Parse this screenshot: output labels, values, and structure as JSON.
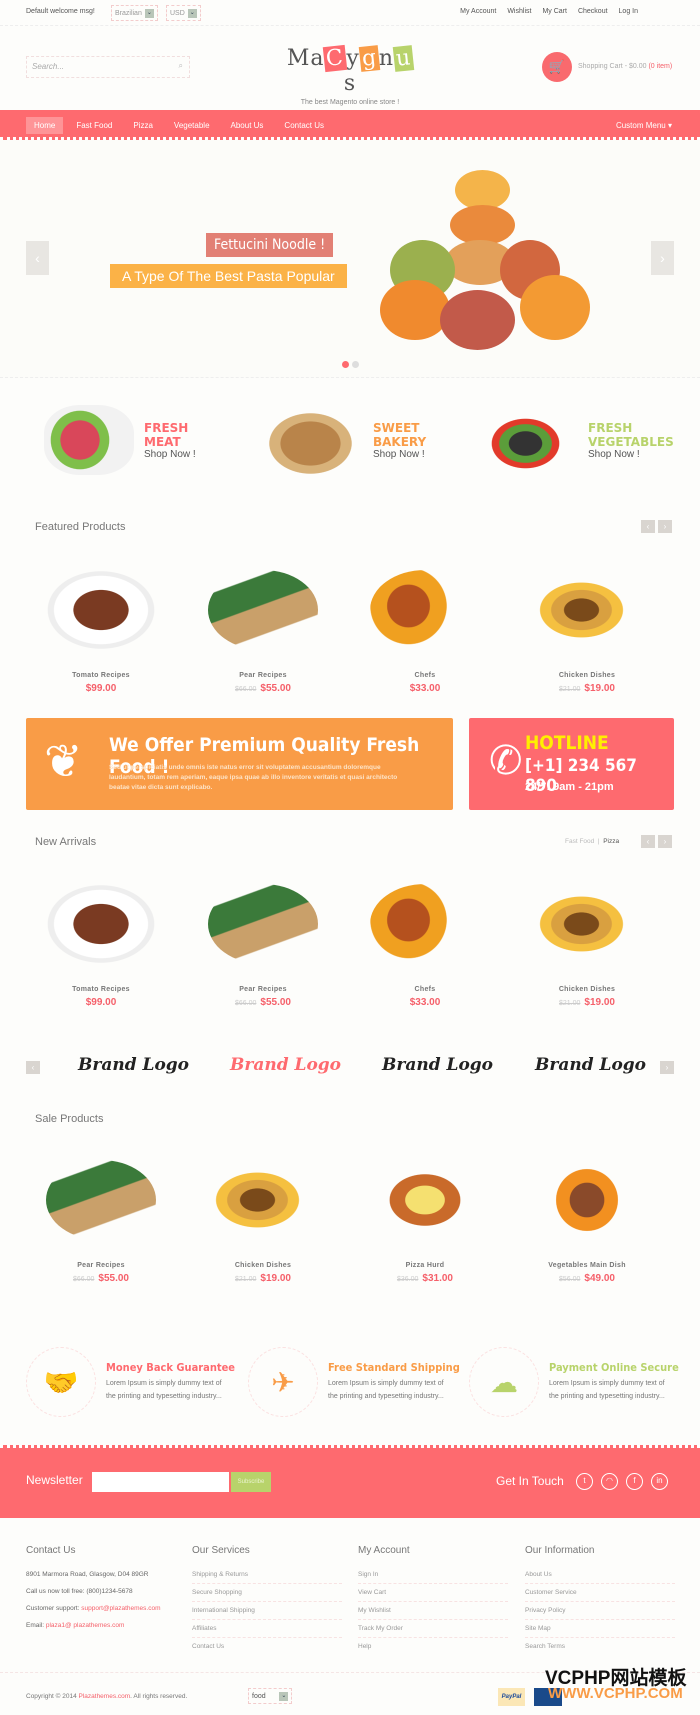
{
  "topbar": {
    "welcome": "Default welcome msg!",
    "language": "Brazilian",
    "currency": "USD",
    "links": [
      "My Account",
      "Wishlist",
      "My Cart",
      "Checkout",
      "Log In"
    ]
  },
  "header": {
    "search_placeholder": "Search...",
    "logo_text": "MaCygnus",
    "tagline": "The best Magento online store !",
    "cart_label": "Shopping Cart -",
    "cart_total": "$0.00",
    "cart_items": "(0 item)"
  },
  "nav": {
    "items": [
      "Home",
      "Fast Food",
      "Pizza",
      "Vegetable",
      "About Us",
      "Contact Us"
    ],
    "custom_menu": "Custom Menu"
  },
  "slider": {
    "caption1": "Fettucini Noodle !",
    "caption2": "A Type Of The Best Pasta Popular"
  },
  "categories": [
    {
      "line1": "FRESH",
      "line2": "MEAT",
      "cta": "Shop Now !",
      "color": "#fe6a6f"
    },
    {
      "line1": "SWEET",
      "line2": "BAKERY",
      "cta": "Shop Now !",
      "color": "#f99c47"
    },
    {
      "line1": "FRESH",
      "line2": "VEGETABLES",
      "cta": "Shop Now !",
      "color": "#b8d36b"
    }
  ],
  "featured": {
    "title": "Featured Products",
    "products": [
      {
        "name": "Tomato Recipes",
        "price": "$99.00",
        "old": ""
      },
      {
        "name": "Pear Recipes",
        "price": "$55.00",
        "old": "$66.00"
      },
      {
        "name": "Chefs",
        "price": "$33.00",
        "old": ""
      },
      {
        "name": "Chicken Dishes",
        "price": "$19.00",
        "old": "$21.00"
      }
    ]
  },
  "promo": {
    "title": "We Offer Premium Quality Fresh Food !",
    "text": "Sed ut perspiciatis unde omnis iste natus error sit voluptatem accusantium doloremque laudantium, totam rem aperiam, eaque ipsa quae ab illo inventore veritatis et quasi architecto beatae vitae dicta sunt explicabo."
  },
  "hotline": {
    "title": "HOTLINE",
    "phone": "[+1] 234 567 890",
    "hours": "24/7: 9am - 21pm"
  },
  "new_arrivals": {
    "title": "New Arrivals",
    "tabs": [
      "Fast Food",
      "Pizza"
    ],
    "products": [
      {
        "name": "Tomato Recipes",
        "price": "$99.00",
        "old": ""
      },
      {
        "name": "Pear Recipes",
        "price": "$55.00",
        "old": "$66.00"
      },
      {
        "name": "Chefs",
        "price": "$33.00",
        "old": ""
      },
      {
        "name": "Chicken Dishes",
        "price": "$19.00",
        "old": "$21.00"
      }
    ]
  },
  "brands": [
    "Brand Logo",
    "Brand Logo",
    "Brand Logo",
    "Brand Logo"
  ],
  "sale": {
    "title": "Sale Products",
    "products": [
      {
        "name": "Pear Recipes",
        "price": "$55.00",
        "old": "$66.00"
      },
      {
        "name": "Chicken Dishes",
        "price": "$19.00",
        "old": "$21.00"
      },
      {
        "name": "Pizza Hurd",
        "price": "$31.00",
        "old": "$36.00"
      },
      {
        "name": "Vegetables Main Dish",
        "price": "$49.00",
        "old": "$56.00"
      }
    ]
  },
  "features": [
    {
      "title": "Money Back Guarantee",
      "text": "Lorem Ipsum is simply dummy text of the printing and typesetting industry...",
      "color": "#fe6a6f"
    },
    {
      "title": "Free Standard Shipping",
      "text": "Lorem Ipsum is simply dummy text of the printing and typesetting industry...",
      "color": "#f99c47"
    },
    {
      "title": "Payment Online Secure",
      "text": "Lorem Ipsum is simply dummy text of the printing and typesetting industry...",
      "color": "#b8d36b"
    }
  ],
  "newsletter": {
    "label": "Newsletter",
    "button": "Subscribe",
    "get_in_touch": "Get In Touch"
  },
  "footer": {
    "contact": {
      "title": "Contact Us",
      "address": "8901 Marmora Road, Glasgow, D04 89GR",
      "phone": "Call us now toll free: (800)1234-5678",
      "support_label": "Customer support:",
      "support_email": "support@plazathemes.com",
      "email_label": "Email:",
      "email": "plaza1@ plazathemes.com"
    },
    "services": {
      "title": "Our Services",
      "links": [
        "Shipping & Returns",
        "Secure Shopping",
        "International Shipping",
        "Affiliates",
        "Contact Us"
      ]
    },
    "account": {
      "title": "My Account",
      "links": [
        "Sign In",
        "View Cart",
        "My Wishlist",
        "Track My Order",
        "Help"
      ]
    },
    "info": {
      "title": "Our Information",
      "links": [
        "About Us",
        "Customer Service",
        "Privacy Policy",
        "Site Map",
        "Search Terms"
      ]
    },
    "copyright_pre": "Copyright © 2014",
    "copyright_link": "Plazathemes.com",
    "copyright_post": ". All rights reserved.",
    "store_select": "food",
    "payment": "PayPal",
    "watermark": "VCPHP网站模板",
    "watermark_url": "WWW.VCPHP.COM"
  },
  "colors": {
    "primary": "#fe6a6f",
    "orange": "#f99c47",
    "green": "#b8d36b"
  }
}
